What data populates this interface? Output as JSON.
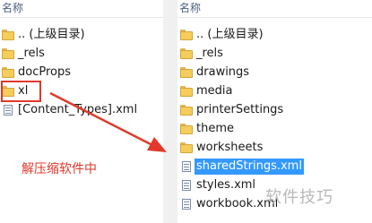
{
  "left_pane": {
    "column_header": "名称",
    "items": [
      {
        "label": ".. (上级目录)",
        "icon": "folder-icon"
      },
      {
        "label": "_rels",
        "icon": "folder-icon"
      },
      {
        "label": "docProps",
        "icon": "folder-icon"
      },
      {
        "label": "xl",
        "icon": "folder-icon"
      },
      {
        "label": "[Content_Types].xml",
        "icon": "xml-file-icon"
      }
    ]
  },
  "right_pane": {
    "column_header": "名称",
    "items": [
      {
        "label": ".. (上级目录)",
        "icon": "folder-icon"
      },
      {
        "label": "_rels",
        "icon": "folder-icon"
      },
      {
        "label": "drawings",
        "icon": "folder-icon"
      },
      {
        "label": "media",
        "icon": "folder-icon"
      },
      {
        "label": "printerSettings",
        "icon": "folder-icon"
      },
      {
        "label": "theme",
        "icon": "folder-icon"
      },
      {
        "label": "worksheets",
        "icon": "folder-icon"
      },
      {
        "label": "sharedStrings.xml",
        "icon": "xml-file-icon",
        "selected": true
      },
      {
        "label": "styles.xml",
        "icon": "xml-file-icon"
      },
      {
        "label": "workbook.xml",
        "icon": "xml-file-icon"
      }
    ]
  },
  "annotation": {
    "caption": "解压缩软件中",
    "color": "#e0392b"
  },
  "watermark": "软件技巧",
  "colors": {
    "selection": "#3399ff",
    "folder": "#f5cd5c",
    "header_text": "#4d6082"
  }
}
